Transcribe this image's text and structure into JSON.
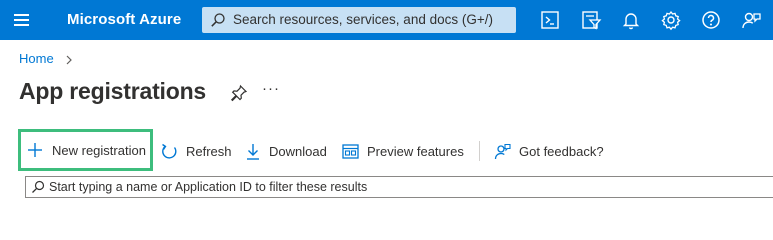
{
  "topbar": {
    "brand": "Microsoft Azure",
    "search_placeholder": "Search resources, services, and docs (G+/)",
    "icons": [
      "cloud-shell-icon",
      "directory-filter-icon",
      "notifications-icon",
      "settings-icon",
      "help-icon",
      "feedback-icon"
    ]
  },
  "breadcrumb": {
    "home": "Home",
    "separator": ">"
  },
  "page": {
    "title": "App registrations",
    "more": "···"
  },
  "toolbar": {
    "new_registration": "New registration",
    "refresh": "Refresh",
    "download": "Download",
    "preview_features": "Preview features",
    "got_feedback": "Got feedback?"
  },
  "filter": {
    "placeholder": "Start typing a name or Application ID to filter these results"
  },
  "colors": {
    "topbar": "#0078d4",
    "search_bg": "#c7e0f4",
    "accent": "#0078d4",
    "highlight": "#3dbd7d",
    "text": "#323130"
  }
}
